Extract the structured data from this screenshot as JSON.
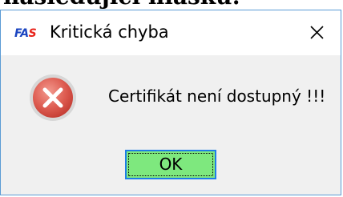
{
  "background_caption": "následující hlášku:",
  "window": {
    "title": "Kritická chyba",
    "app_icon_text_a": "FA",
    "app_icon_text_b": "S",
    "close_glyph": "×",
    "message": "Certifikát není dostupný !!!",
    "ok_label": "OK",
    "icon": "error-icon",
    "colors": {
      "border": "#5b9bd5",
      "ok_button": "#7ee87e",
      "ok_border": "#1e7ee6",
      "error_red": "#d9433b"
    }
  }
}
